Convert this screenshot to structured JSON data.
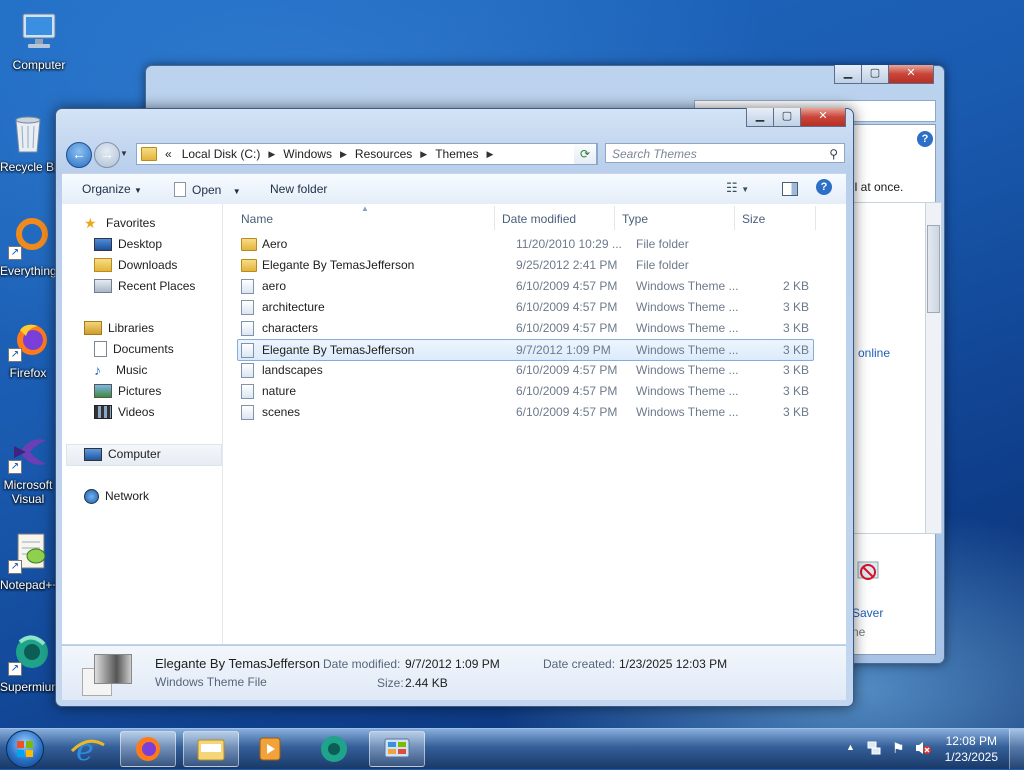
{
  "desktop": {
    "icons": [
      {
        "label": "Computer"
      },
      {
        "label": "Recycle Bin"
      },
      {
        "label": "Everything"
      },
      {
        "label": "Firefox"
      },
      {
        "label": "Microsoft Visual Studio"
      },
      {
        "label": "Notepad++"
      },
      {
        "label": "Supermium"
      }
    ]
  },
  "back_window": {
    "text_all_at_once": "ll at once.",
    "text_online": "online",
    "screen_saver_label": "Saver",
    "screen_saver_sub": "ne"
  },
  "window": {
    "address": {
      "overflow": "«",
      "crumbs": [
        "Local Disk (C:)",
        "Windows",
        "Resources",
        "Themes"
      ]
    },
    "search_placeholder": "Search Themes",
    "toolbar": {
      "organize": "Organize",
      "open": "Open",
      "new_folder": "New folder"
    },
    "nav": {
      "favorites": "Favorites",
      "desktop": "Desktop",
      "downloads": "Downloads",
      "recent_places": "Recent Places",
      "libraries": "Libraries",
      "documents": "Documents",
      "music": "Music",
      "pictures": "Pictures",
      "videos": "Videos",
      "computer": "Computer",
      "network": "Network"
    },
    "columns": {
      "name": "Name",
      "date": "Date modified",
      "type": "Type",
      "size": "Size"
    },
    "files": [
      {
        "name": "Aero",
        "date": "11/20/2010 10:29 ...",
        "type": "File folder",
        "size": "",
        "kind": "folder"
      },
      {
        "name": "Elegante By TemasJefferson",
        "date": "9/25/2012 2:41 PM",
        "type": "File folder",
        "size": "",
        "kind": "folder"
      },
      {
        "name": "aero",
        "date": "6/10/2009 4:57 PM",
        "type": "Windows Theme ...",
        "size": "2 KB",
        "kind": "theme"
      },
      {
        "name": "architecture",
        "date": "6/10/2009 4:57 PM",
        "type": "Windows Theme ...",
        "size": "3 KB",
        "kind": "theme"
      },
      {
        "name": "characters",
        "date": "6/10/2009 4:57 PM",
        "type": "Windows Theme ...",
        "size": "3 KB",
        "kind": "theme"
      },
      {
        "name": "Elegante By TemasJefferson",
        "date": "9/7/2012 1:09 PM",
        "type": "Windows Theme ...",
        "size": "3 KB",
        "kind": "theme",
        "selected": true
      },
      {
        "name": "landscapes",
        "date": "6/10/2009 4:57 PM",
        "type": "Windows Theme ...",
        "size": "3 KB",
        "kind": "theme"
      },
      {
        "name": "nature",
        "date": "6/10/2009 4:57 PM",
        "type": "Windows Theme ...",
        "size": "3 KB",
        "kind": "theme"
      },
      {
        "name": "scenes",
        "date": "6/10/2009 4:57 PM",
        "type": "Windows Theme ...",
        "size": "3 KB",
        "kind": "theme"
      }
    ],
    "details": {
      "name": "Elegante By TemasJefferson",
      "type": "Windows Theme File",
      "date_modified_label": "Date modified:",
      "date_modified": "9/7/2012 1:09 PM",
      "date_created_label": "Date created:",
      "date_created": "1/23/2025 12:03 PM",
      "size_label": "Size:",
      "size": "2.44 KB"
    }
  },
  "taskbar": {
    "time": "12:08 PM",
    "date": "1/23/2025"
  },
  "colors": {
    "accent": "#3399ff",
    "selection_border": "#84acdd",
    "close_red": "#c9453a"
  }
}
